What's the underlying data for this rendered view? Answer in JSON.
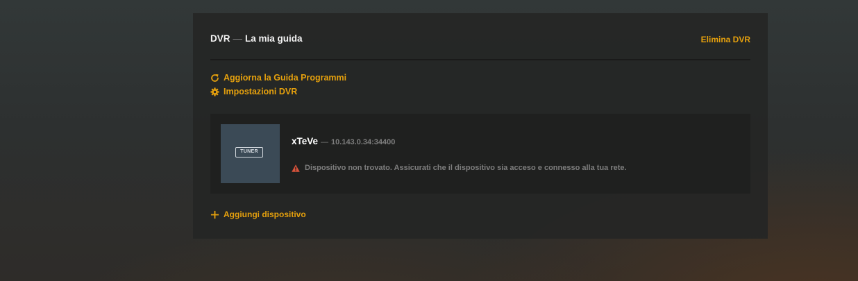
{
  "header": {
    "dvr_label": "DVR",
    "separator": "—",
    "guide_name": "La mia guida",
    "delete_label": "Elimina DVR"
  },
  "actions": {
    "refresh_guide": "Aggiorna la Guida Programmi",
    "dvr_settings": "Impostazioni DVR",
    "add_device": "Aggiungi dispositivo"
  },
  "device": {
    "badge": "TUNER",
    "name": "xTeVe",
    "separator": "—",
    "address": "10.143.0.34:34400",
    "error_message": "Dispositivo non trovato. Assicurati che il dispositivo sia acceso e connesso alla tua rete."
  },
  "icons": {
    "refresh": "refresh-icon",
    "settings": "gear-icon",
    "warning": "warning-icon",
    "add": "plus-icon"
  },
  "colors": {
    "accent": "#e5a00d",
    "warning": "#d9533b",
    "muted_text": "#7e7e7e",
    "thumb_bg": "#3b4a56"
  }
}
